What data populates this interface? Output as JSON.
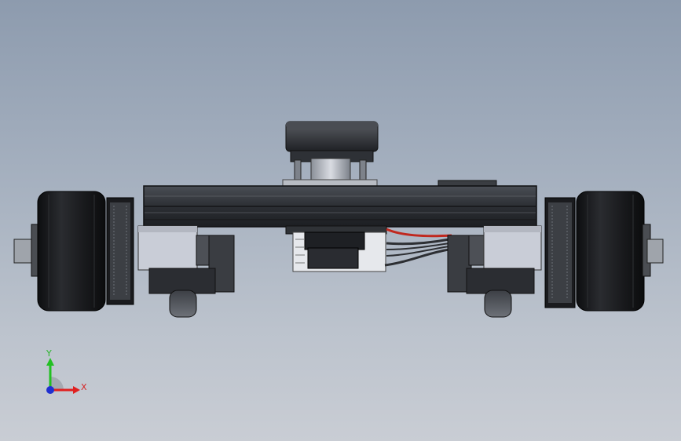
{
  "triad": {
    "x_label": "X",
    "y_label": "Y",
    "x_color": "#e02020",
    "y_color": "#22c022",
    "z_color": "#2030d0"
  },
  "model": {
    "wheel_icon": "wheel-icon",
    "motor_icon": "motor-icon",
    "body_color": "#2f3236",
    "tire_color": "#111214",
    "housing_color": "#c8ccd6",
    "wire_red": "#c0281e"
  }
}
